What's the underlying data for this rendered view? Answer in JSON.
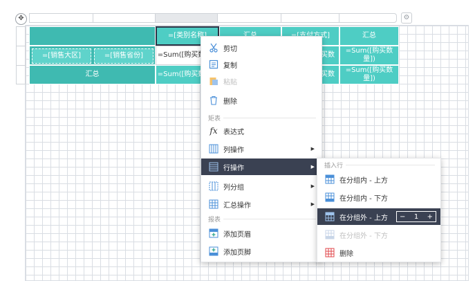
{
  "canvas": {
    "header_cells": {
      "category": "=[类别名称]",
      "summary_1": "汇总",
      "payment": "=[支付方式]",
      "summary_2": "汇总"
    },
    "row_cells": {
      "region": "=[销售大区]",
      "province": "=[销售省份]",
      "sum_qty_1": "=Sum([购买数量])",
      "sum_qty_2": "买数",
      "sum_qty_3": "=Sum([购买数量])"
    },
    "total_cells": {
      "label": "汇总",
      "sum_qty_1": "=Sum([购买数量])",
      "sum_qty_2": "买数",
      "sum_qty_3": "=Sum([购买数量])"
    },
    "move_icon": "move-icon",
    "settings_icon": "gear-icon"
  },
  "context_menu": {
    "items": [
      {
        "label": "剪切",
        "icon": "scissors-icon"
      },
      {
        "label": "复制",
        "icon": "copy-icon"
      },
      {
        "label": "粘贴",
        "icon": "paste-icon",
        "disabled": true
      },
      {
        "label": "删除",
        "icon": "trash-icon"
      }
    ],
    "section_matrix": "矩表",
    "matrix_items": [
      {
        "label": "表达式",
        "icon": "fx-icon"
      },
      {
        "label": "列操作",
        "icon": "columns-icon",
        "submenu": true
      },
      {
        "label": "行操作",
        "icon": "rows-icon",
        "submenu": true,
        "active": true
      },
      {
        "label": "列分组",
        "icon": "column-group-icon",
        "submenu": true
      },
      {
        "label": "汇总操作",
        "icon": "summary-icon",
        "submenu": true
      }
    ],
    "section_report": "报表",
    "report_items": [
      {
        "label": "添加页眉",
        "icon": "header-icon"
      },
      {
        "label": "添加页脚",
        "icon": "footer-icon"
      }
    ]
  },
  "row_submenu": {
    "section_insert": "插入行",
    "items": [
      {
        "label": "在分组内 - 上方",
        "icon": "row-insert-icon"
      },
      {
        "label": "在分组内 - 下方",
        "icon": "row-insert-icon"
      },
      {
        "label": "在分组外 - 上方",
        "icon": "row-insert-icon",
        "active": true
      },
      {
        "label": "在分组外 - 下方",
        "icon": "row-insert-icon",
        "disabled": true
      },
      {
        "label": "删除",
        "icon": "row-delete-icon"
      }
    ],
    "stepper": {
      "minus": "−",
      "value": "1",
      "plus": "+"
    }
  },
  "colors": {
    "teal": "#4ecdc4",
    "menu_active": "#3a4152",
    "grid": "#d9dde3"
  }
}
